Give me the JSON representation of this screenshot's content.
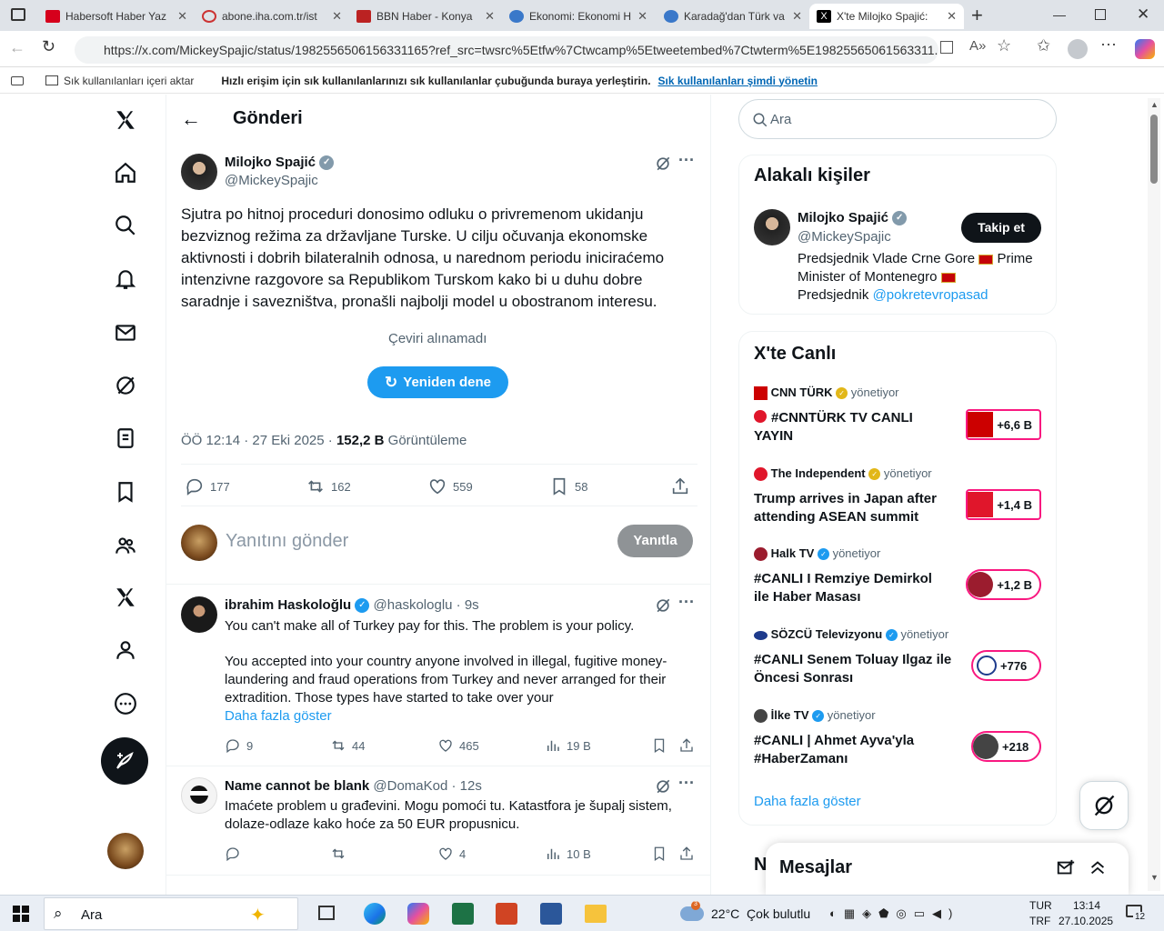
{
  "browser": {
    "tabs": [
      {
        "label": "Habersoft Haber Yaz",
        "color": "#d6001c"
      },
      {
        "label": "abone.iha.com.tr/ist",
        "color": "#c33"
      },
      {
        "label": "BBN Haber - Konya",
        "color": "#b22"
      },
      {
        "label": "Ekonomi: Ekonomi H",
        "color": "#3a78c9"
      },
      {
        "label": "Karadağ'dan Türk va",
        "color": "#3a78c9"
      },
      {
        "label": "X'te Milojko Spajić:",
        "color": "#000"
      }
    ],
    "url": "https://x.com/MickeySpajic/status/1982556506156331165?ref_src=twsrc%5Etfw%7Ctwcamp%5Etweetembed%7Ctwterm%5E19825565061563311...",
    "favbar_import": "Sık kullanılanları içeri aktar",
    "favbar_hint": "Hızlı erişim için sık kullanılanlarınızı sık kullanılanlar çubuğunda buraya yerleştirin.",
    "favbar_link": "Sık kullanılanları şimdi yönetin"
  },
  "header": {
    "title": "Gönderi"
  },
  "post": {
    "name": "Milojko Spajić",
    "handle": "@MickeySpajic",
    "text": "Sjutra po hitnoj proceduri donosimo odluku o privremenom ukidanju bezviznog režima za državljane Turske. U cilju očuvanja ekonomske aktivnosti i dobrih bilateralnih odnosa, u narednom periodu iniciraćemo intenzivne razgovore sa Republikom Turskom kako bi u duhu dobre saradnje i savezništva, pronašli najbolji model u obostranom interesu.",
    "translate_failed": "Çeviri alınamadı",
    "retry": "Yeniden dene",
    "time": "ÖÖ 12:14 · 27 Eki 2025 · ",
    "views_count": "152,2 B",
    "views_label": " Görüntüleme",
    "replies": "177",
    "reposts": "162",
    "likes": "559",
    "bookmarks": "58"
  },
  "compose": {
    "placeholder": "Yanıtını gönder",
    "button": "Yanıtla"
  },
  "replies": [
    {
      "name": "ibrahim Haskoloğlu",
      "handle": "@haskologlu",
      "time": "· 9s",
      "line1": "You can't make all of Turkey pay for this. The problem is your policy.",
      "line2": "You accepted into your country anyone involved in illegal, fugitive money-laundering and fraud operations from Turkey and never arranged for their extradition. Those types have started to take over your",
      "more": "Daha fazla göster",
      "replies": "9",
      "reposts": "44",
      "likes": "465",
      "views": "19 B"
    },
    {
      "name": "Name cannot be blank",
      "handle": "@DomaKod",
      "time": "· 12s",
      "line1": "Imaćete problem u građevini. Mogu pomoći tu. Katastfora je šupalj sistem, dolaze-odlaze kako hoće za 50 EUR propusnicu.",
      "replies": "",
      "reposts": "",
      "likes": "4",
      "views": "10 B"
    }
  ],
  "sidebar": {
    "search_placeholder": "Ara",
    "related_title": "Alakalı kişiler",
    "related": {
      "name": "Milojko Spajić",
      "handle": "@MickeySpajic",
      "follow": "Takip et",
      "bio1": "Predsjednik Vlade Crne Gore",
      "bio2": "Prime",
      "bio3": "Minister of Montenegro",
      "bio4": "Predsjednik",
      "bio_link": "@pokretevropasad"
    },
    "live_title": "X'te Canlı",
    "live": [
      {
        "host": "CNN TÜRK",
        "hosting": "yönetiyor",
        "title": "#CNNTÜRK TV CANLI YAYIN",
        "count": "+6,6 B",
        "icon_color": "#cc0000",
        "live_dot": true
      },
      {
        "host": "The Independent",
        "hosting": "yönetiyor",
        "title": "Trump arrives in Japan after attending ASEAN summit",
        "count": "+1,4 B",
        "icon_color": "#e0162b"
      },
      {
        "host": "Halk TV",
        "hosting": "yönetiyor",
        "title": "#CANLI I Remziye Demirkol ile Haber Masası",
        "count": "+1,2 B",
        "icon_color": "#9b1c2e"
      },
      {
        "host": "SÖZCÜ Televizyonu",
        "hosting": "yönetiyor",
        "title": "#CANLI Senem Toluay Ilgaz ile Öncesi Sonrası",
        "count": "+776",
        "icon_color": "#1e3b8c"
      },
      {
        "host": "İlke TV",
        "hosting": "yönetiyor",
        "title": "#CANLI | Ahmet Ayva'yla #HaberZamanı",
        "count": "+218",
        "icon_color": "#444"
      }
    ],
    "show_more": "Daha fazla göster",
    "messages": "Mesajlar"
  },
  "taskbar": {
    "search": "Ara",
    "weather": "22°C  Çok bulutlu",
    "lang1": "TUR",
    "lang2": "TRF",
    "time": "13:14",
    "date": "27.10.2025",
    "notif": "12"
  }
}
